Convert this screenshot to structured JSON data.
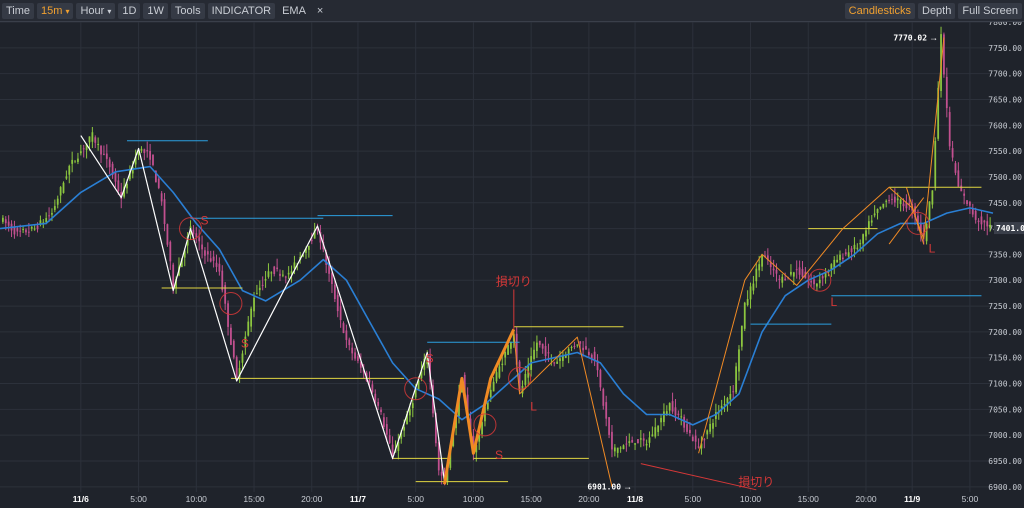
{
  "toolbar": {
    "time_label": "Time",
    "interval_label": "15m",
    "hour_label": "Hour",
    "d1_label": "1D",
    "w1_label": "1W",
    "tools_label": "Tools",
    "indicator_label": "INDICATOR",
    "ema_label": "EMA",
    "ema_close": "×",
    "candlesticks_label": "Candlesticks",
    "depth_label": "Depth",
    "fullscreen_label": "Full Screen",
    "caret": "▾"
  },
  "colors": {
    "background": "#1f232b",
    "grid": "#2c313b",
    "up": "#8cc63f",
    "down": "#c2508f",
    "ema": "#2a7fd4",
    "zigzag": "#ffffff",
    "trend": "#f08a24",
    "support": "#e0d641",
    "resistance": "#2b9fe0",
    "annotation": "#d63838"
  },
  "chart_data": {
    "type": "candlestick",
    "y_axis": {
      "ylim": [
        6890,
        7800
      ],
      "ticks": [
        6900,
        6950,
        7000,
        7050,
        7100,
        7150,
        7200,
        7250,
        7300,
        7350,
        7400,
        7450,
        7500,
        7550,
        7600,
        7650,
        7700,
        7750,
        7800
      ],
      "tick_labels": [
        "6900.00",
        "6950.00",
        "7000.00",
        "7050.00",
        "7100.00",
        "7150.00",
        "7200.00",
        "7250.00",
        "7300.00",
        "7350.00",
        "7400.00",
        "7450.00",
        "7500.00",
        "7550.00",
        "7600.00",
        "7650.00",
        "7700.00",
        "7750.00",
        "7800.00"
      ]
    },
    "x_axis": {
      "time_range": [
        "11/5 17:00",
        "11/9 07:00"
      ],
      "ticks": [
        {
          "t": "11/6 00:00",
          "label": "11/6",
          "bold": true
        },
        {
          "t": "11/6 05:00",
          "label": "5:00"
        },
        {
          "t": "11/6 10:00",
          "label": "10:00"
        },
        {
          "t": "11/6 15:00",
          "label": "15:00"
        },
        {
          "t": "11/6 20:00",
          "label": "20:00"
        },
        {
          "t": "11/7 00:00",
          "label": "11/7",
          "bold": true
        },
        {
          "t": "11/7 05:00",
          "label": "5:00"
        },
        {
          "t": "11/7 10:00",
          "label": "10:00"
        },
        {
          "t": "11/7 15:00",
          "label": "15:00"
        },
        {
          "t": "11/7 20:00",
          "label": "20:00"
        },
        {
          "t": "11/8 00:00",
          "label": "11/8",
          "bold": true
        },
        {
          "t": "11/8 05:00",
          "label": "5:00"
        },
        {
          "t": "11/8 10:00",
          "label": "10:00"
        },
        {
          "t": "11/8 15:00",
          "label": "15:00"
        },
        {
          "t": "11/8 20:00",
          "label": "20:00"
        },
        {
          "t": "11/9 00:00",
          "label": "11/9",
          "bold": true
        },
        {
          "t": "11/9 05:00",
          "label": "5:00"
        }
      ]
    },
    "price_path": [
      [
        "11/5 17:00",
        7420
      ],
      [
        "11/5 18:30",
        7390
      ],
      [
        "11/5 20:00",
        7400
      ],
      [
        "11/5 21:30",
        7430
      ],
      [
        "11/5 23:00",
        7520
      ],
      [
        "11/6 01:00",
        7580
      ],
      [
        "11/6 02:30",
        7520
      ],
      [
        "11/6 03:30",
        7460
      ],
      [
        "11/6 05:00",
        7555
      ],
      [
        "11/6 06:00",
        7540
      ],
      [
        "11/6 07:00",
        7450
      ],
      [
        "11/6 08:00",
        7290
      ],
      [
        "11/6 09:30",
        7400
      ],
      [
        "11/6 10:30",
        7360
      ],
      [
        "11/6 12:00",
        7320
      ],
      [
        "11/6 13:30",
        7110
      ],
      [
        "11/6 15:00",
        7270
      ],
      [
        "11/6 16:30",
        7320
      ],
      [
        "11/6 18:00",
        7310
      ],
      [
        "11/6 20:30",
        7400
      ],
      [
        "11/6 21:30",
        7310
      ],
      [
        "11/6 23:00",
        7180
      ],
      [
        "11/7 01:00",
        7100
      ],
      [
        "11/7 02:00",
        7040
      ],
      [
        "11/7 03:00",
        6960
      ],
      [
        "11/7 04:30",
        7050
      ],
      [
        "11/7 06:00",
        7160
      ],
      [
        "11/7 07:00",
        6930
      ],
      [
        "11/7 07:30",
        6910
      ],
      [
        "11/7 09:00",
        7110
      ],
      [
        "11/7 10:00",
        6965
      ],
      [
        "11/7 11:30",
        7090
      ],
      [
        "11/7 13:30",
        7200
      ],
      [
        "11/7 14:00",
        7080
      ],
      [
        "11/7 15:30",
        7180
      ],
      [
        "11/7 17:00",
        7140
      ],
      [
        "11/7 19:00",
        7180
      ],
      [
        "11/7 20:30",
        7150
      ],
      [
        "11/7 21:30",
        7030
      ],
      [
        "11/7 22:00",
        6970
      ],
      [
        "11/8 00:00",
        6990
      ],
      [
        "11/8 01:00",
        6985
      ],
      [
        "11/8 03:00",
        7060
      ],
      [
        "11/8 04:00",
        7030
      ],
      [
        "11/8 05:30",
        6975
      ],
      [
        "11/8 07:00",
        7040
      ],
      [
        "11/8 08:30",
        7090
      ],
      [
        "11/8 09:30",
        7250
      ],
      [
        "11/8 11:00",
        7350
      ],
      [
        "11/8 12:30",
        7300
      ],
      [
        "11/8 14:00",
        7320
      ],
      [
        "11/8 15:30",
        7290
      ],
      [
        "11/8 17:30",
        7340
      ],
      [
        "11/8 19:30",
        7370
      ],
      [
        "11/8 20:30",
        7420
      ],
      [
        "11/8 22:00",
        7460
      ],
      [
        "11/9 00:00",
        7440
      ],
      [
        "11/9 01:00",
        7380
      ],
      [
        "11/9 01:45",
        7480
      ],
      [
        "11/9 02:30",
        7770
      ],
      [
        "11/9 03:15",
        7560
      ],
      [
        "11/9 04:00",
        7480
      ],
      [
        "11/9 05:30",
        7420
      ],
      [
        "11/9 07:00",
        7401
      ]
    ],
    "ema_path": [
      [
        "11/5 17:00",
        7400
      ],
      [
        "11/5 21:00",
        7410
      ],
      [
        "11/6 00:00",
        7470
      ],
      [
        "11/6 03:00",
        7510
      ],
      [
        "11/6 06:00",
        7520
      ],
      [
        "11/6 08:00",
        7470
      ],
      [
        "11/6 10:00",
        7410
      ],
      [
        "11/6 12:00",
        7360
      ],
      [
        "11/6 14:00",
        7280
      ],
      [
        "11/6 16:00",
        7260
      ],
      [
        "11/6 19:00",
        7300
      ],
      [
        "11/6 21:00",
        7340
      ],
      [
        "11/6 23:00",
        7300
      ],
      [
        "11/7 01:00",
        7220
      ],
      [
        "11/7 03:00",
        7140
      ],
      [
        "11/7 05:00",
        7090
      ],
      [
        "11/7 07:00",
        7070
      ],
      [
        "11/7 09:00",
        7030
      ],
      [
        "11/7 11:00",
        7060
      ],
      [
        "11/7 13:00",
        7100
      ],
      [
        "11/7 15:00",
        7140
      ],
      [
        "11/7 17:00",
        7150
      ],
      [
        "11/7 19:00",
        7160
      ],
      [
        "11/7 21:00",
        7140
      ],
      [
        "11/7 23:00",
        7080
      ],
      [
        "11/8 01:00",
        7040
      ],
      [
        "11/8 03:00",
        7040
      ],
      [
        "11/8 05:00",
        7020
      ],
      [
        "11/8 07:00",
        7040
      ],
      [
        "11/8 09:00",
        7080
      ],
      [
        "11/8 11:00",
        7200
      ],
      [
        "11/8 13:00",
        7270
      ],
      [
        "11/8 15:00",
        7300
      ],
      [
        "11/8 17:00",
        7320
      ],
      [
        "11/8 19:00",
        7350
      ],
      [
        "11/8 21:00",
        7390
      ],
      [
        "11/8 23:00",
        7410
      ],
      [
        "11/9 01:00",
        7410
      ],
      [
        "11/9 03:00",
        7430
      ],
      [
        "11/9 05:00",
        7440
      ],
      [
        "11/9 07:00",
        7430
      ]
    ],
    "zigzag": [
      [
        "11/6 00:00",
        7580
      ],
      [
        "11/6 03:30",
        7460
      ],
      [
        "11/6 05:00",
        7555
      ],
      [
        "11/6 08:00",
        7280
      ],
      [
        "11/6 09:30",
        7400
      ],
      [
        "11/6 13:30",
        7105
      ],
      [
        "11/6 20:30",
        7405
      ],
      [
        "11/7 03:00",
        6955
      ],
      [
        "11/7 06:00",
        7160
      ],
      [
        "11/7 07:30",
        6910
      ]
    ],
    "trend_lines": [
      {
        "width": 3,
        "points": [
          [
            "11/7 07:30",
            6905
          ],
          [
            "11/7 09:00",
            7110
          ],
          [
            "11/7 10:00",
            6965
          ],
          [
            "11/7 11:30",
            7110
          ],
          [
            "11/7 13:30",
            7205
          ]
        ]
      },
      {
        "width": 1,
        "points": [
          [
            "11/7 13:30",
            7200
          ],
          [
            "11/7 14:00",
            7080
          ],
          [
            "11/7 19:00",
            7190
          ],
          [
            "11/7 22:00",
            6900
          ]
        ]
      },
      {
        "width": 1,
        "points": [
          [
            "11/8 05:30",
            6965
          ],
          [
            "11/8 09:30",
            7300
          ],
          [
            "11/8 11:00",
            7350
          ],
          [
            "11/8 14:00",
            7290
          ],
          [
            "11/8 18:00",
            7400
          ],
          [
            "11/8 22:00",
            7480
          ],
          [
            "11/9 00:00",
            7440
          ],
          [
            "11/9 01:00",
            7380
          ],
          [
            "11/9 02:45",
            7770
          ]
        ]
      },
      {
        "width": 1,
        "points": [
          [
            "11/8 23:30",
            7480
          ],
          [
            "11/9 01:00",
            7370
          ]
        ]
      },
      {
        "width": 1,
        "points": [
          [
            "11/8 22:00",
            7370
          ],
          [
            "11/9 01:00",
            7460
          ]
        ]
      }
    ],
    "support_levels": [
      {
        "price": 7285,
        "from": "11/6 07:00",
        "to": "11/6 14:00"
      },
      {
        "price": 7110,
        "from": "11/6 13:00",
        "to": "11/7 04:00"
      },
      {
        "price": 6955,
        "from": "11/7 03:00",
        "to": "11/7 08:00"
      },
      {
        "price": 6910,
        "from": "11/7 05:00",
        "to": "11/7 13:00"
      },
      {
        "price": 6955,
        "from": "11/7 10:00",
        "to": "11/7 20:00"
      },
      {
        "price": 7210,
        "from": "11/7 13:30",
        "to": "11/7 23:00"
      },
      {
        "price": 7400,
        "from": "11/8 15:00",
        "to": "11/8 21:00"
      },
      {
        "price": 7480,
        "from": "11/8 22:00",
        "to": "11/9 06:00"
      }
    ],
    "resistance_levels": [
      {
        "price": 7570,
        "from": "11/6 04:00",
        "to": "11/6 11:00"
      },
      {
        "price": 7420,
        "from": "11/6 09:30",
        "to": "11/6 21:00"
      },
      {
        "price": 7425,
        "from": "11/6 20:30",
        "to": "11/7 03:00"
      },
      {
        "price": 7180,
        "from": "11/7 06:00",
        "to": "11/7 14:00"
      },
      {
        "price": 7215,
        "from": "11/8 10:00",
        "to": "11/8 17:00"
      },
      {
        "price": 7270,
        "from": "11/8 17:00",
        "to": "11/9 06:00"
      }
    ],
    "signals": [
      {
        "t": "11/6 09:30",
        "price": 7400,
        "label": "S",
        "label_dy": -8
      },
      {
        "t": "11/6 13:00",
        "price": 7255,
        "label": "S",
        "label_dy": 40
      },
      {
        "t": "11/7 05:00",
        "price": 7090,
        "label": "S",
        "label_dy": -30
      },
      {
        "t": "11/7 11:00",
        "price": 7020,
        "label": "S",
        "label_dy": 30
      },
      {
        "t": "11/7 14:00",
        "price": 7110,
        "label": "L",
        "label_dy": 28
      },
      {
        "t": "11/8 16:00",
        "price": 7300,
        "label": "L",
        "label_dy": 22
      },
      {
        "t": "11/9 00:30",
        "price": 7410,
        "label": "L",
        "label_dy": 25
      }
    ],
    "annotations": [
      {
        "text": "損切り",
        "t": "11/7 13:30",
        "price": 7290,
        "arrow_to": [
          "11/7 13:30",
          "7205"
        ]
      },
      {
        "text": "損切り",
        "t": "11/8 10:30",
        "price": 6902,
        "arrow_to": [
          "11/8 00:30",
          "6945"
        ]
      }
    ],
    "price_markers": [
      {
        "label": "7770.02",
        "t": "11/9 02:30",
        "price": 7770
      },
      {
        "label": "6901.00",
        "t": "11/8 00:00",
        "price": 6901
      }
    ],
    "last_price": {
      "price": 7401.0,
      "label": "7401.0"
    }
  }
}
